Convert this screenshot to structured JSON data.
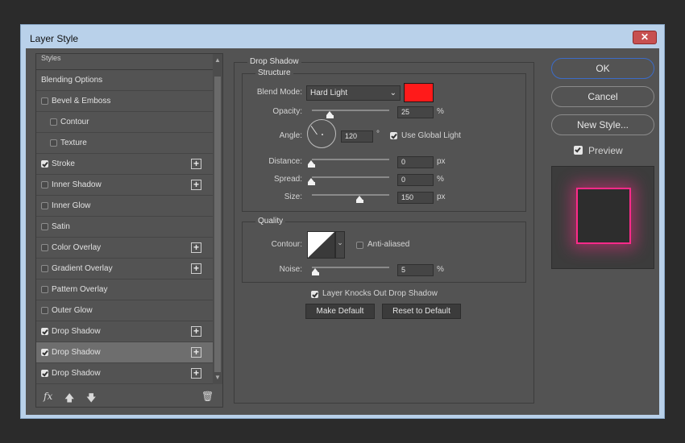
{
  "window": {
    "title": "Layer Style",
    "close_glyph": "✕"
  },
  "styles_panel": {
    "header": "Styles",
    "items": [
      {
        "label": "Blending Options",
        "checked": null,
        "plus": false,
        "indent": false
      },
      {
        "label": "Bevel & Emboss",
        "checked": false,
        "plus": false,
        "indent": false
      },
      {
        "label": "Contour",
        "checked": false,
        "plus": false,
        "indent": true
      },
      {
        "label": "Texture",
        "checked": false,
        "plus": false,
        "indent": true
      },
      {
        "label": "Stroke",
        "checked": true,
        "plus": true,
        "indent": false
      },
      {
        "label": "Inner Shadow",
        "checked": false,
        "plus": true,
        "indent": false
      },
      {
        "label": "Inner Glow",
        "checked": false,
        "plus": false,
        "indent": false
      },
      {
        "label": "Satin",
        "checked": false,
        "plus": false,
        "indent": false
      },
      {
        "label": "Color Overlay",
        "checked": false,
        "plus": true,
        "indent": false
      },
      {
        "label": "Gradient Overlay",
        "checked": false,
        "plus": true,
        "indent": false
      },
      {
        "label": "Pattern Overlay",
        "checked": false,
        "plus": false,
        "indent": false
      },
      {
        "label": "Outer Glow",
        "checked": false,
        "plus": false,
        "indent": false
      },
      {
        "label": "Drop Shadow",
        "checked": true,
        "plus": true,
        "indent": false
      },
      {
        "label": "Drop Shadow",
        "checked": true,
        "plus": true,
        "indent": false,
        "selected": true
      },
      {
        "label": "Drop Shadow",
        "checked": true,
        "plus": true,
        "indent": false
      }
    ],
    "bottom_icons": {
      "fx": "fx",
      "up": "🡅",
      "down": "🡇",
      "delete": "🗑"
    }
  },
  "drop_shadow": {
    "section_title": "Drop Shadow",
    "structure": {
      "title": "Structure",
      "blend_mode_label": "Blend Mode:",
      "blend_mode_value": "Hard Light",
      "shadow_color": "#ff1a1a",
      "opacity_label": "Opacity:",
      "opacity_value": "25",
      "opacity_unit": "%",
      "angle_label": "Angle:",
      "angle_value": "120",
      "angle_unit": "°",
      "use_global_light_label": "Use Global Light",
      "use_global_light": true,
      "distance_label": "Distance:",
      "distance_value": "0",
      "distance_unit": "px",
      "spread_label": "Spread:",
      "spread_value": "0",
      "spread_unit": "%",
      "size_label": "Size:",
      "size_value": "150",
      "size_unit": "px"
    },
    "quality": {
      "title": "Quality",
      "contour_label": "Contour:",
      "anti_aliased_label": "Anti-aliased",
      "anti_aliased": false,
      "noise_label": "Noise:",
      "noise_value": "5",
      "noise_unit": "%"
    },
    "knocks_out_label": "Layer Knocks Out Drop Shadow",
    "knocks_out": true,
    "make_default_label": "Make Default",
    "reset_default_label": "Reset to Default"
  },
  "actions": {
    "ok_label": "OK",
    "cancel_label": "Cancel",
    "new_style_label": "New Style...",
    "preview_label": "Preview",
    "preview_checked": true
  },
  "preview": {
    "glow_color": "#ff2a8a",
    "square_color": "#2d2d2d",
    "bg_color": "#3c3c3c"
  }
}
